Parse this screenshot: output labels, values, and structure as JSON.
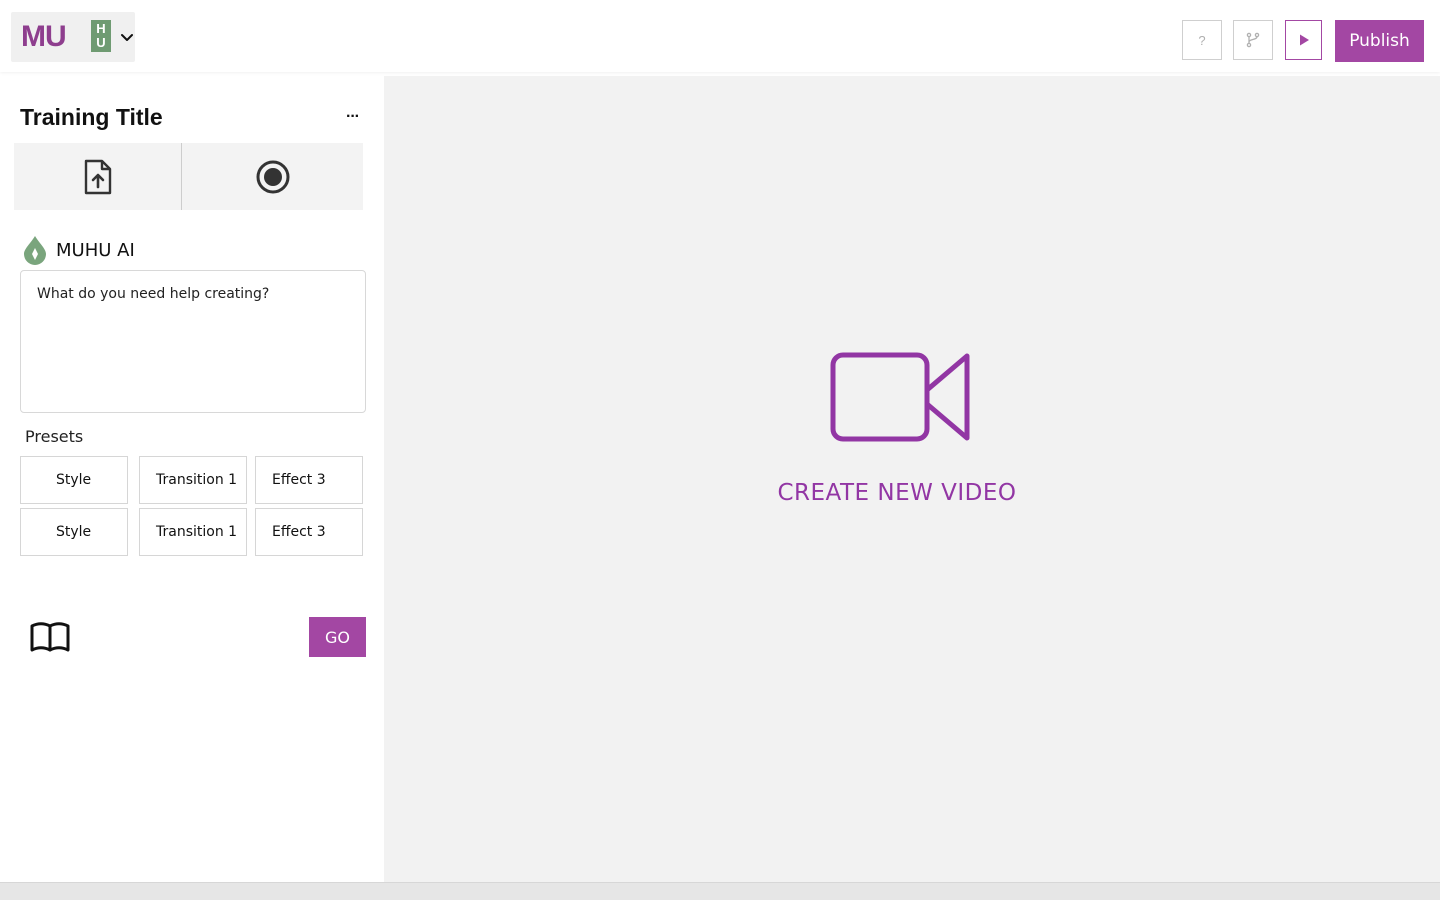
{
  "header": {
    "logo": {
      "text_main": "MU",
      "text_box": [
        "H",
        "U"
      ],
      "brand_purple": "#8e3e8e",
      "brand_green": "#6f9b72"
    },
    "help_label": "?",
    "publish_label": "Publish",
    "accent": "#a347a3"
  },
  "sidebar": {
    "title": "Training Title",
    "more_label": "···",
    "tools": [
      {
        "icon": "file-upload-icon"
      },
      {
        "icon": "record-icon"
      }
    ],
    "ai": {
      "label": "MUHU AI",
      "icon": "muhu-ai-drop-icon"
    },
    "prompt": {
      "placeholder": "What do you need help creating?",
      "value": ""
    },
    "presets_label": "Presets",
    "presets": [
      [
        "Style",
        "Transition 1",
        "Effect 3"
      ],
      [
        "Style",
        "Transition 1",
        "Effect 3"
      ]
    ],
    "go_label": "GO"
  },
  "canvas": {
    "create_label": "CREATE NEW VIDEO",
    "icon": "video-camera-icon",
    "icon_color": "#9236a4"
  }
}
